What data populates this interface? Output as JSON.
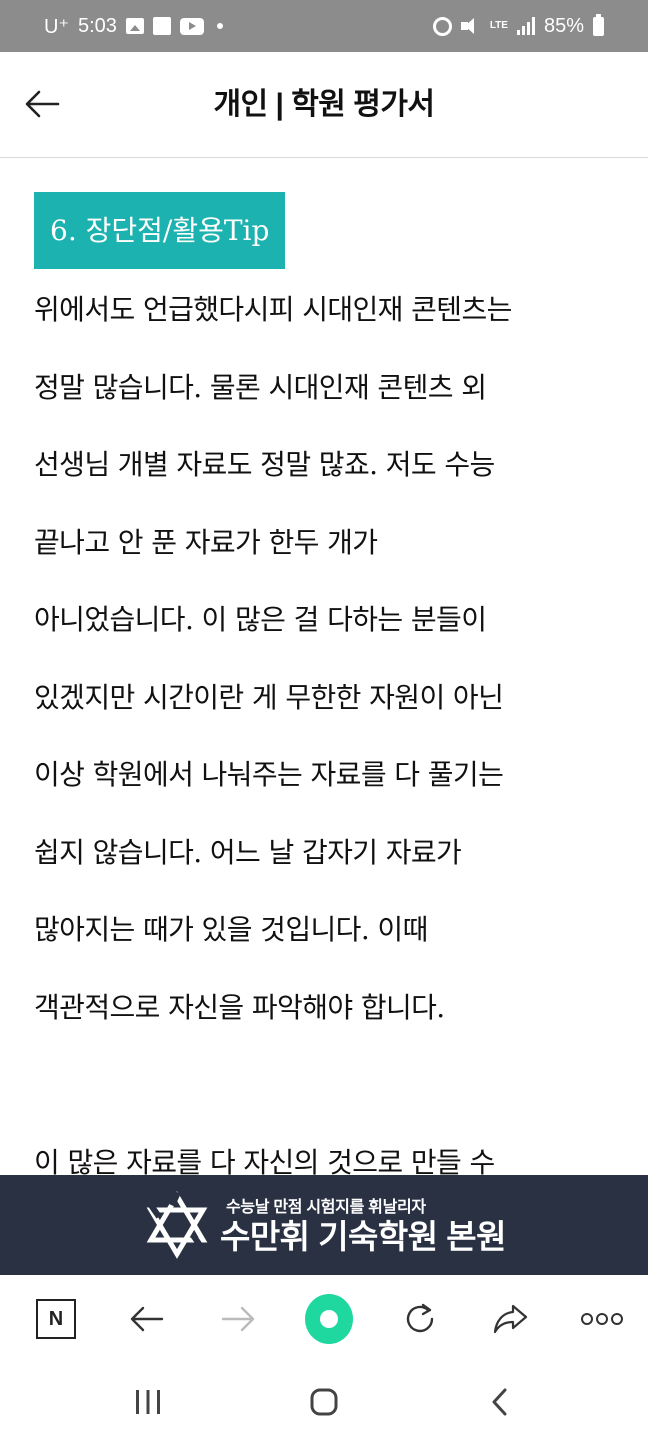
{
  "status_bar": {
    "carrier": "U⁺",
    "time": "5:03",
    "network": "LTE",
    "battery": "85%"
  },
  "header": {
    "title": "개인 | 학원 평가서"
  },
  "article": {
    "section_heading": "6. 장단점/활용Tip",
    "paragraph_lines": [
      "위에서도 언급했다시피 시대인재 콘텐츠는",
      "정말 많습니다. 물론 시대인재 콘텐츠 외",
      "선생님 개별 자료도 정말 많죠. 저도 수능",
      "끝나고 안 푼 자료가 한두 개가",
      "아니었습니다. 이 많은 걸 다하는 분들이",
      "있겠지만 시간이란 게 무한한 자원이 아닌",
      "이상 학원에서 나눠주는 자료를 다 풀기는",
      "쉽지 않습니다. 어느 날 갑자기 자료가",
      "많아지는 때가 있을 것입니다. 이때",
      "객관적으로 자신을 파악해야 합니다."
    ],
    "next_paragraph_line": "이 많은 자료를 다 자신의 것으로 만들 수"
  },
  "ad_banner": {
    "subtitle": "수능날 만점 시험지를 휘날리자",
    "title": "수만휘 기숙학원 본원"
  },
  "toolbar": {
    "naver_label": "N"
  },
  "colors": {
    "heading_bg": "#1cb2b0",
    "banner_bg": "#2a3143",
    "accent_green": "#1ed8a0",
    "status_bar_bg": "#8c8c8c"
  },
  "icons": {
    "header": [
      "back-arrow-icon"
    ],
    "toolbar": [
      "naver-icon",
      "back-arrow-icon",
      "forward-arrow-icon",
      "green-dot-icon",
      "refresh-icon",
      "share-icon",
      "more-dots-icon"
    ],
    "nav": [
      "recent-apps-icon",
      "home-icon",
      "nav-back-icon"
    ]
  }
}
